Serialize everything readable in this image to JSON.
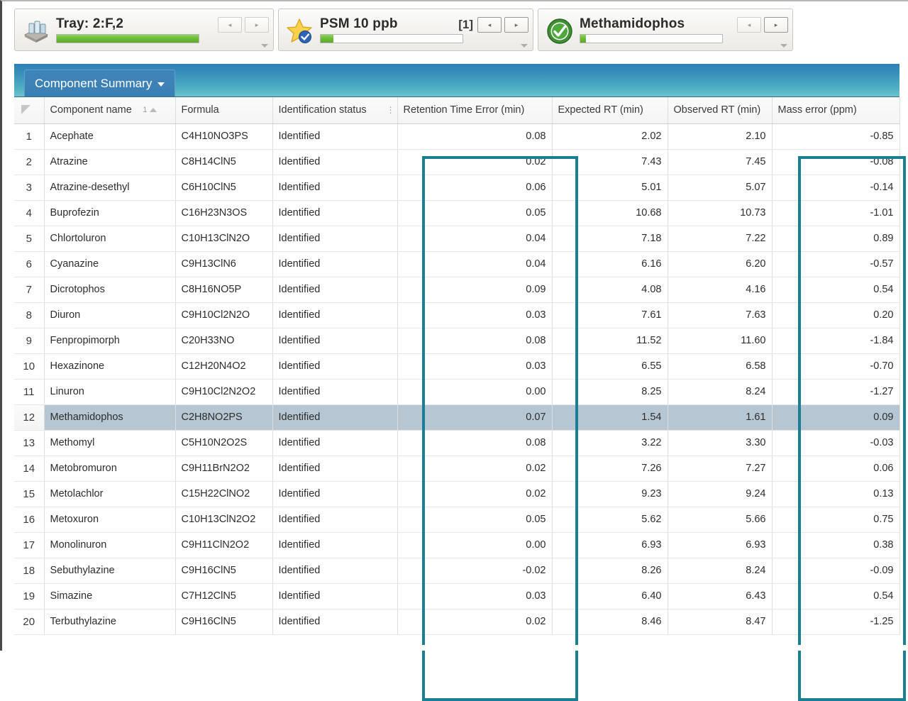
{
  "statusbar": {
    "tray": {
      "icon": "tray-icon",
      "title": "Tray: 2:F,2",
      "progress_percent": 100,
      "prev_label": "◂",
      "next_label": "▸"
    },
    "sample": {
      "icon": "star-check-icon",
      "title": "PSM 10 ppb",
      "count": "[1]",
      "progress_percent": 9,
      "prev_label": "◂",
      "next_label": "▸"
    },
    "component": {
      "icon": "green-check-icon",
      "title": "Methamidophos",
      "progress_percent": 4,
      "prev_label": "◂",
      "next_label": "▸"
    }
  },
  "tab": {
    "label": "Component Summary",
    "caret": "▾"
  },
  "table": {
    "sort_column_index": "1",
    "columns": [
      "Component name",
      "Formula",
      "Identification status",
      "Retention Time Error (min)",
      "Expected RT (min)",
      "Observed RT (min)",
      "Mass error (ppm)"
    ],
    "selected_row_number": 12,
    "rows": [
      {
        "n": "1",
        "name": "Acephate",
        "formula": "C4H10NO3PS",
        "status": "Identified",
        "rte": "0.08",
        "ert": "2.02",
        "ort": "2.10",
        "mass": "-0.85"
      },
      {
        "n": "2",
        "name": "Atrazine",
        "formula": "C8H14ClN5",
        "status": "Identified",
        "rte": "0.02",
        "ert": "7.43",
        "ort": "7.45",
        "mass": "-0.08"
      },
      {
        "n": "3",
        "name": "Atrazine-desethyl",
        "formula": "C6H10ClN5",
        "status": "Identified",
        "rte": "0.06",
        "ert": "5.01",
        "ort": "5.07",
        "mass": "-0.14"
      },
      {
        "n": "4",
        "name": "Buprofezin",
        "formula": "C16H23N3OS",
        "status": "Identified",
        "rte": "0.05",
        "ert": "10.68",
        "ort": "10.73",
        "mass": "-1.01"
      },
      {
        "n": "5",
        "name": "Chlortoluron",
        "formula": "C10H13ClN2O",
        "status": "Identified",
        "rte": "0.04",
        "ert": "7.18",
        "ort": "7.22",
        "mass": "0.89"
      },
      {
        "n": "6",
        "name": "Cyanazine",
        "formula": "C9H13ClN6",
        "status": "Identified",
        "rte": "0.04",
        "ert": "6.16",
        "ort": "6.20",
        "mass": "-0.57"
      },
      {
        "n": "7",
        "name": "Dicrotophos",
        "formula": "C8H16NO5P",
        "status": "Identified",
        "rte": "0.09",
        "ert": "4.08",
        "ort": "4.16",
        "mass": "0.54"
      },
      {
        "n": "8",
        "name": "Diuron",
        "formula": "C9H10Cl2N2O",
        "status": "Identified",
        "rte": "0.03",
        "ert": "7.61",
        "ort": "7.63",
        "mass": "0.20"
      },
      {
        "n": "9",
        "name": "Fenpropimorph",
        "formula": "C20H33NO",
        "status": "Identified",
        "rte": "0.08",
        "ert": "11.52",
        "ort": "11.60",
        "mass": "-1.84"
      },
      {
        "n": "10",
        "name": "Hexazinone",
        "formula": "C12H20N4O2",
        "status": "Identified",
        "rte": "0.03",
        "ert": "6.55",
        "ort": "6.58",
        "mass": "-0.70"
      },
      {
        "n": "11",
        "name": "Linuron",
        "formula": "C9H10Cl2N2O2",
        "status": "Identified",
        "rte": "0.00",
        "ert": "8.25",
        "ort": "8.24",
        "mass": "-1.27"
      },
      {
        "n": "12",
        "name": "Methamidophos",
        "formula": "C2H8NO2PS",
        "status": "Identified",
        "rte": "0.07",
        "ert": "1.54",
        "ort": "1.61",
        "mass": "0.09"
      },
      {
        "n": "13",
        "name": "Methomyl",
        "formula": "C5H10N2O2S",
        "status": "Identified",
        "rte": "0.08",
        "ert": "3.22",
        "ort": "3.30",
        "mass": "-0.03"
      },
      {
        "n": "14",
        "name": "Metobromuron",
        "formula": "C9H11BrN2O2",
        "status": "Identified",
        "rte": "0.02",
        "ert": "7.26",
        "ort": "7.27",
        "mass": "0.06"
      },
      {
        "n": "15",
        "name": "Metolachlor",
        "formula": "C15H22ClNO2",
        "status": "Identified",
        "rte": "0.02",
        "ert": "9.23",
        "ort": "9.24",
        "mass": "0.13"
      },
      {
        "n": "16",
        "name": "Metoxuron",
        "formula": "C10H13ClN2O2",
        "status": "Identified",
        "rte": "0.05",
        "ert": "5.62",
        "ort": "5.66",
        "mass": "0.75"
      },
      {
        "n": "17",
        "name": "Monolinuron",
        "formula": "C9H11ClN2O2",
        "status": "Identified",
        "rte": "0.00",
        "ert": "6.93",
        "ort": "6.93",
        "mass": "0.38"
      },
      {
        "n": "18",
        "name": "Sebuthylazine",
        "formula": "C9H16ClN5",
        "status": "Identified",
        "rte": "-0.02",
        "ert": "8.26",
        "ort": "8.24",
        "mass": "-0.09"
      },
      {
        "n": "19",
        "name": "Simazine",
        "formula": "C7H12ClN5",
        "status": "Identified",
        "rte": "0.03",
        "ert": "6.40",
        "ort": "6.43",
        "mass": "0.54"
      },
      {
        "n": "20",
        "name": "Terbuthylazine",
        "formula": "C9H16ClN5",
        "status": "Identified",
        "rte": "0.02",
        "ert": "8.46",
        "ort": "8.47",
        "mass": "-1.25"
      }
    ]
  },
  "highlights": {
    "accent_color": "#1a7f95",
    "boxes": [
      "Retention Time Error (min)",
      "Mass error (ppm)"
    ]
  },
  "colors": {
    "tab_band_start": "#2e7fb5",
    "tab_band_end": "#6cc4cd",
    "progress_green": "#6cbb37",
    "selected_row": "#b6c7d3",
    "highlight_teal": "#1a7f95"
  }
}
